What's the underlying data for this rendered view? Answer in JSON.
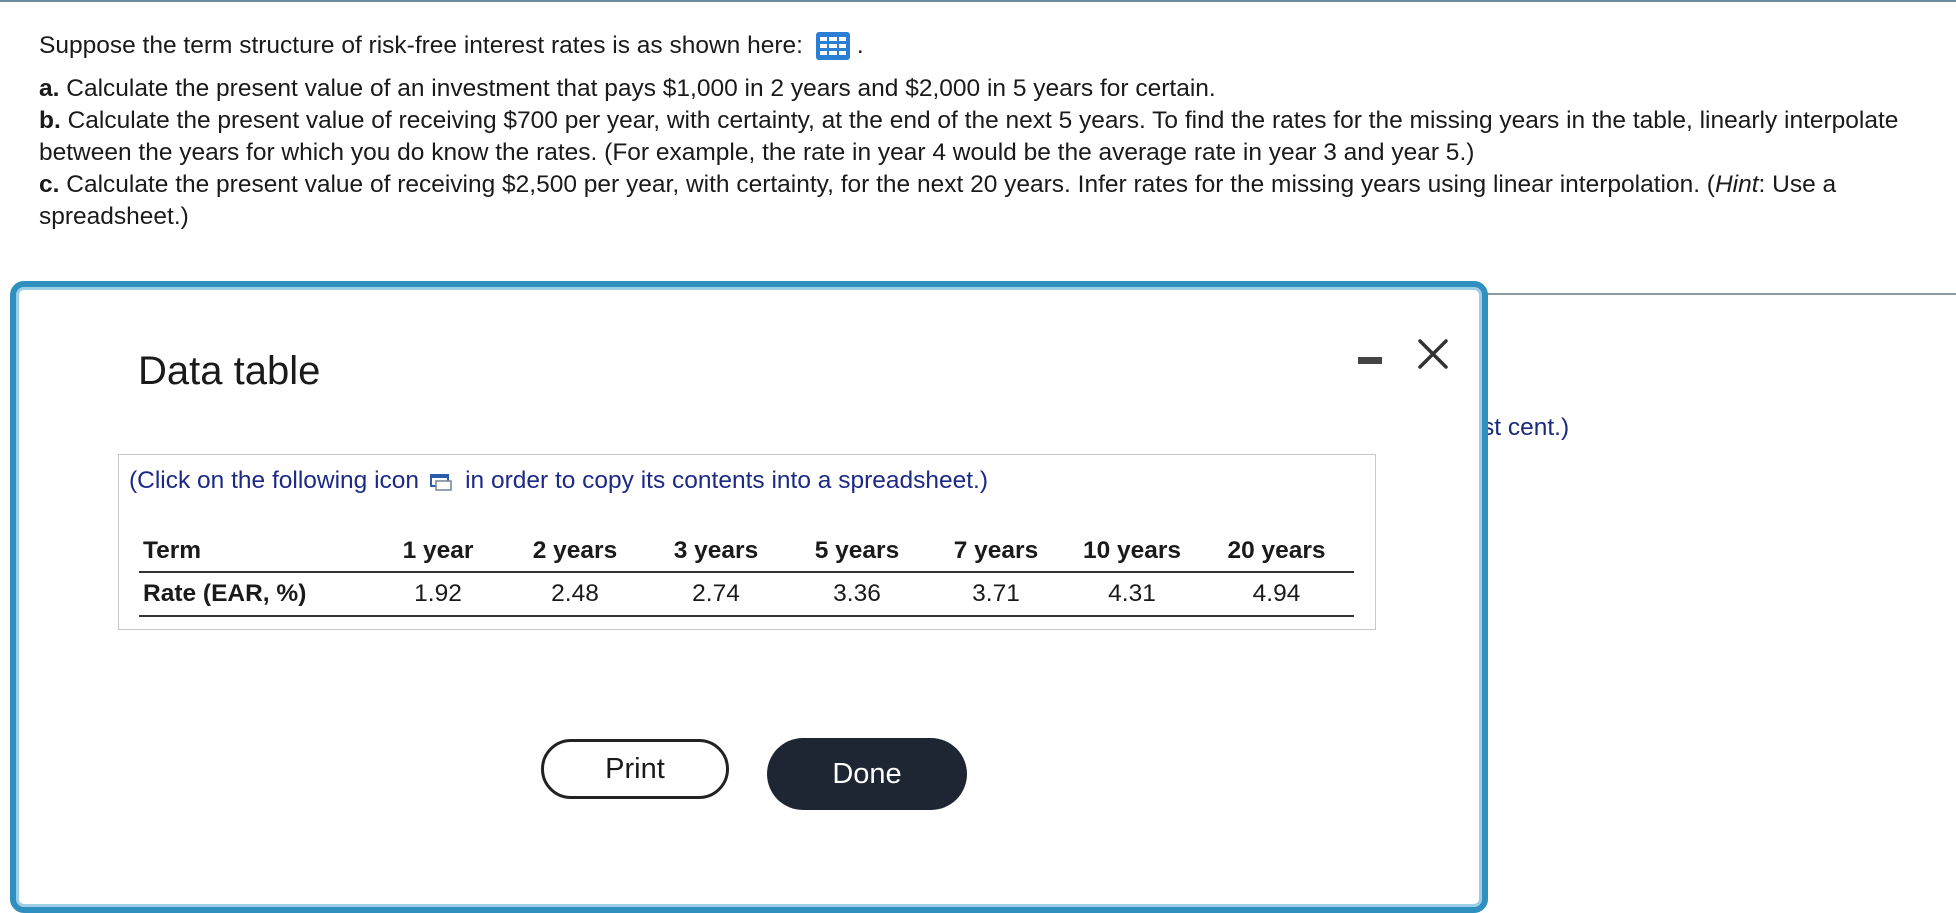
{
  "question": {
    "intro": "Suppose the term structure of risk-free interest rates is as shown here:",
    "intro_suffix": ".",
    "part_a_label": "a.",
    "part_a_text": "Calculate the present value of an investment that pays $1,000 in 2 years and $2,000 in 5 years for certain.",
    "part_b_label": "b.",
    "part_b_text": "Calculate the present value of receiving $700 per year, with certainty, at the end of the next 5 years. To find the rates for the missing years in the table, linearly interpolate between the years for which you do know the rates. (For example, the rate in year 4 would be the average rate in year 3 and year 5.)",
    "part_c_label": "c.",
    "part_c_text_1": "Calculate the present value of receiving $2,500 per year, with certainty, for the next 20 years. Infer rates for the missing years using linear interpolation. (",
    "part_c_hint": "Hint",
    "part_c_text_2": ": Use a spreadsheet.)"
  },
  "behind_text": "st cent.)",
  "modal": {
    "title": "Data table",
    "copy_note_before": "(Click on the following icon",
    "copy_note_after": "in order to copy its contents into a spreadsheet.)",
    "table": {
      "row1_label": "Term",
      "row2_label": "Rate (EAR, %)",
      "terms": [
        "1 year",
        "2 years",
        "3 years",
        "5 years",
        "7 years",
        "10 years",
        "20 years"
      ],
      "rates": [
        "1.92",
        "2.48",
        "2.74",
        "3.36",
        "3.71",
        "4.31",
        "4.94"
      ]
    },
    "print_label": "Print",
    "done_label": "Done"
  },
  "icons": {
    "data_table": "grid-table-icon",
    "copy": "copy-to-spreadsheet-icon",
    "minimize": "minimize-icon",
    "close": "close-icon"
  },
  "colors": {
    "modal_border": "#2f8fbf",
    "link_blue": "#1c2a86",
    "done_bg": "#1f2633",
    "table_icon": "#2a7fd4"
  }
}
